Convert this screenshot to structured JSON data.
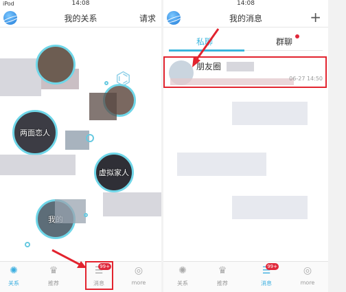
{
  "status": {
    "carrier": "iPod",
    "time_left": "14:08",
    "time_right": "14:08"
  },
  "left": {
    "title": "我的关系",
    "request": "请求",
    "bubbles": [
      "两面恋人",
      "虚拟家人",
      "我的"
    ],
    "tabs": [
      {
        "label": "关系",
        "icon": "planet-tab-icon",
        "active": true
      },
      {
        "label": "推荐",
        "icon": "crown-icon",
        "active": false
      },
      {
        "label": "消息",
        "icon": "message-icon",
        "badge": "99+",
        "active": false
      },
      {
        "label": "more",
        "icon": "more-icon",
        "active": false
      }
    ]
  },
  "right": {
    "title": "我的消息",
    "plus": "+",
    "seg": {
      "private": "私聊",
      "group": "群聊"
    },
    "message": {
      "name": "朋友圈",
      "time": "06-27 14:50"
    },
    "tabs": [
      {
        "label": "关系",
        "icon": "planet-tab-icon",
        "active": false
      },
      {
        "label": "推荐",
        "icon": "crown-icon",
        "active": false
      },
      {
        "label": "消息",
        "icon": "message-icon",
        "badge": "99+",
        "active": true
      },
      {
        "label": "more",
        "icon": "more-icon",
        "active": false
      }
    ]
  },
  "colors": {
    "accent": "#3aaee0",
    "highlight": "#e2232e",
    "badge": "#e0283a"
  }
}
